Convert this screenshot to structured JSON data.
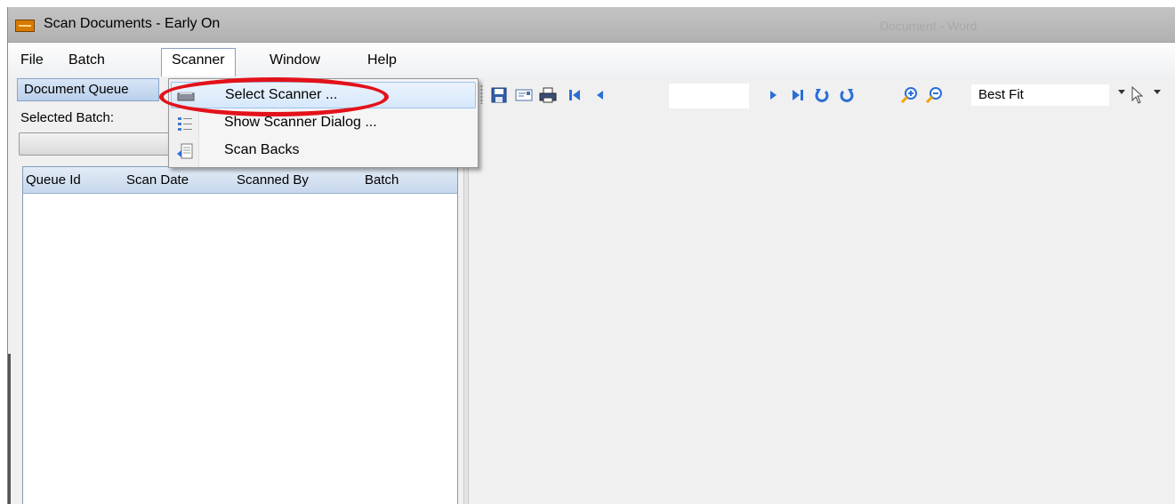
{
  "window": {
    "title": "Scan Documents - Early On",
    "title_right_faded": "Document - Word"
  },
  "menubar": {
    "items": [
      {
        "label": "File"
      },
      {
        "label": "Batch"
      },
      {
        "label": "Scanner"
      },
      {
        "label": "Window"
      },
      {
        "label": "Help"
      }
    ]
  },
  "scanner_menu": {
    "items": [
      {
        "label": "Select Scanner ...",
        "icon": "scanner-icon",
        "highlighted": true
      },
      {
        "label": "Show Scanner Dialog ...",
        "icon": "dialog-list-icon"
      },
      {
        "label": "Scan Backs",
        "icon": "scan-backs-icon"
      }
    ]
  },
  "left_panel": {
    "tab_label": "Document Queue",
    "selected_batch_label": "Selected Batch:",
    "columns": [
      "Queue Id",
      "Scan Date",
      "Scanned By",
      "Batch"
    ],
    "rows": []
  },
  "toolbar": {
    "buttons": [
      "save-icon",
      "email-icon",
      "print-icon",
      "first-page-icon",
      "previous-page-icon",
      "next-page-icon",
      "last-page-icon",
      "rotate-left-icon",
      "rotate-right-icon",
      "zoom-in-icon",
      "zoom-out-icon"
    ],
    "page_value": "",
    "zoom_value": "Best Fit"
  },
  "annotation": {
    "color": "#e3121a"
  }
}
